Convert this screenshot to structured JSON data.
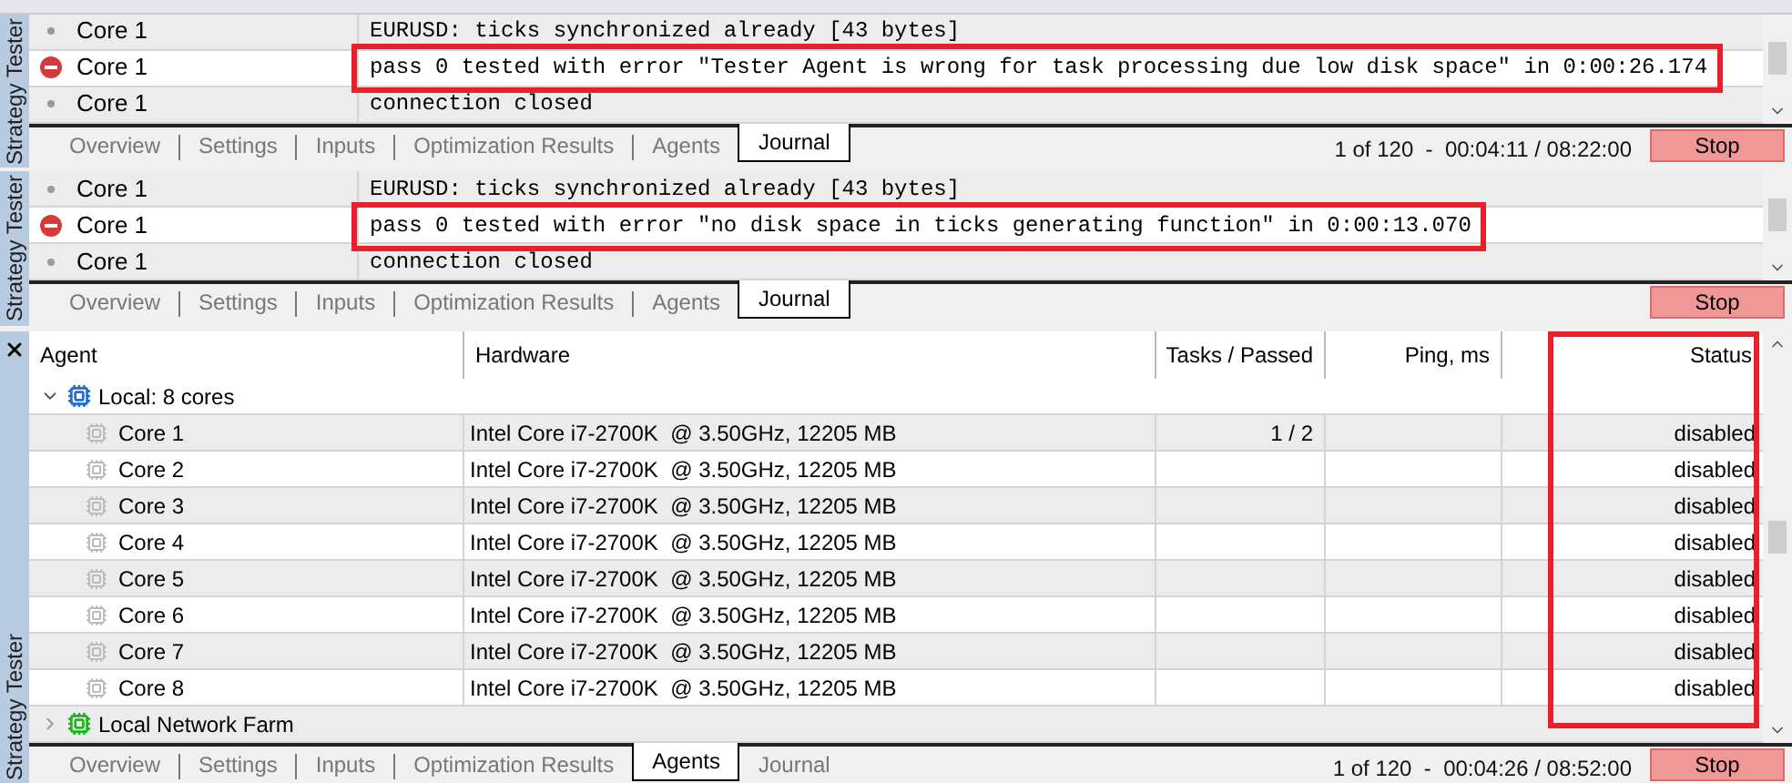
{
  "panels": [
    {
      "sidebar_title": "Strategy Tester",
      "journal": [
        {
          "kind": "info",
          "source": "Core 1",
          "message": "EURUSD: ticks synchronized already [43 bytes]",
          "highlighted": false
        },
        {
          "kind": "error",
          "source": "Core 1",
          "message": "pass 0 tested with error \"Tester Agent is wrong for task processing due low disk space\" in 0:00:26.174",
          "highlighted": true
        },
        {
          "kind": "info",
          "source": "Core 1",
          "message": "connection closed",
          "highlighted": false
        }
      ],
      "tabs": [
        {
          "label": "Overview",
          "selected": false
        },
        {
          "label": "Settings",
          "selected": false
        },
        {
          "label": "Inputs",
          "selected": false
        },
        {
          "label": "Optimization Results",
          "selected": false
        },
        {
          "label": "Agents",
          "selected": false
        },
        {
          "label": "Journal",
          "selected": true
        }
      ],
      "progress": "1 of 120  -  00:04:11 / 08:22:00",
      "stop_button": "Stop"
    },
    {
      "sidebar_title": "Strategy Tester",
      "journal": [
        {
          "kind": "info",
          "source": "Core 1",
          "message": "EURUSD: ticks synchronized already [43 bytes]",
          "highlighted": false
        },
        {
          "kind": "error",
          "source": "Core 1",
          "message": "pass 0 tested with error \"no disk space in ticks generating function\" in 0:00:13.070",
          "highlighted": true
        },
        {
          "kind": "info",
          "source": "Core 1",
          "message": "connection closed",
          "highlighted": false
        }
      ],
      "tabs": [
        {
          "label": "Overview",
          "selected": false
        },
        {
          "label": "Settings",
          "selected": false
        },
        {
          "label": "Inputs",
          "selected": false
        },
        {
          "label": "Optimization Results",
          "selected": false
        },
        {
          "label": "Agents",
          "selected": false
        },
        {
          "label": "Journal",
          "selected": true
        }
      ],
      "stop_button": "Stop"
    }
  ],
  "agents_panel": {
    "sidebar_title": "Strategy Tester",
    "columns": [
      "Agent",
      "Hardware",
      "Tasks / Passed",
      "Ping, ms",
      "Status"
    ],
    "status_column_highlighted": true,
    "groups": [
      {
        "name": "Local: 8 cores",
        "expanded": true,
        "color": "#1e6fd0",
        "children": [
          {
            "name": "Core 1",
            "hardware": "Intel Core i7-2700K  @ 3.50GHz, 12205 MB",
            "tasks": "1 / 2",
            "status": "disabled"
          },
          {
            "name": "Core 2",
            "hardware": "Intel Core i7-2700K  @ 3.50GHz, 12205 MB",
            "status": "disabled"
          },
          {
            "name": "Core 3",
            "hardware": "Intel Core i7-2700K  @ 3.50GHz, 12205 MB",
            "status": "disabled"
          },
          {
            "name": "Core 4",
            "hardware": "Intel Core i7-2700K  @ 3.50GHz, 12205 MB",
            "status": "disabled"
          },
          {
            "name": "Core 5",
            "hardware": "Intel Core i7-2700K  @ 3.50GHz, 12205 MB",
            "status": "disabled"
          },
          {
            "name": "Core 6",
            "hardware": "Intel Core i7-2700K  @ 3.50GHz, 12205 MB",
            "status": "disabled"
          },
          {
            "name": "Core 7",
            "hardware": "Intel Core i7-2700K  @ 3.50GHz, 12205 MB",
            "status": "disabled"
          },
          {
            "name": "Core 8",
            "hardware": "Intel Core i7-2700K  @ 3.50GHz, 12205 MB",
            "status": "disabled"
          }
        ]
      },
      {
        "name": "Local Network Farm",
        "expanded": false,
        "color": "#1fb51f"
      }
    ],
    "tabs": [
      {
        "label": "Overview",
        "selected": false
      },
      {
        "label": "Settings",
        "selected": false
      },
      {
        "label": "Inputs",
        "selected": false
      },
      {
        "label": "Optimization Results",
        "selected": false
      },
      {
        "label": "Agents",
        "selected": true
      },
      {
        "label": "Journal",
        "selected": false
      }
    ],
    "progress": "1 of 120  -  00:04:26 / 08:52:00",
    "stop_button": "Stop"
  }
}
